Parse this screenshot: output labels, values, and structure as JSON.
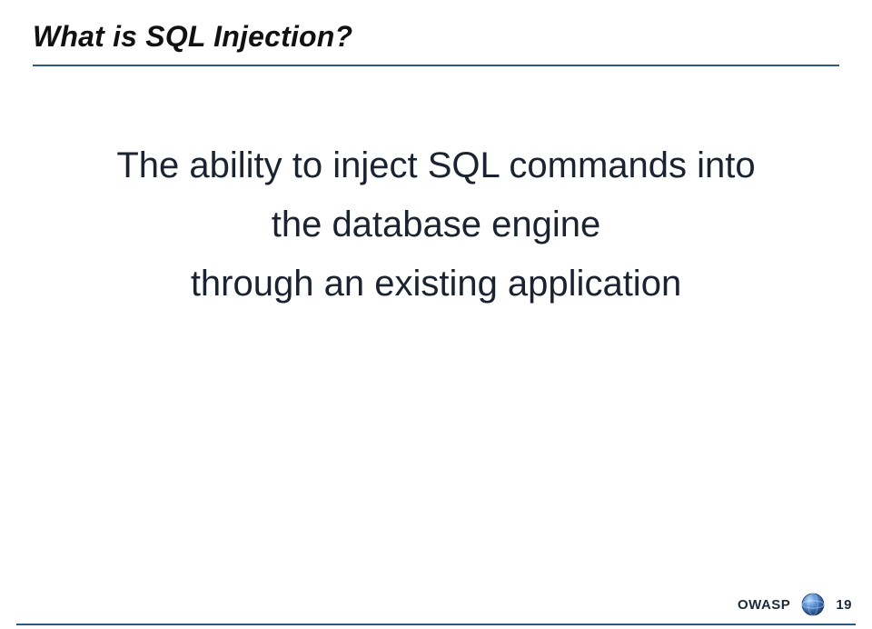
{
  "slide": {
    "title": "What is SQL Injection?",
    "body": {
      "line1": "The ability to inject SQL commands into",
      "line2": "the database engine",
      "line3": "through an existing application"
    }
  },
  "footer": {
    "org_label": "OWASP",
    "logo_name": "owasp-logo",
    "page_number": "19"
  },
  "colors": {
    "rule": "#2a5a8a",
    "logo_gradient_top": "#6aa7e8",
    "logo_gradient_bottom": "#1c3f7a"
  }
}
